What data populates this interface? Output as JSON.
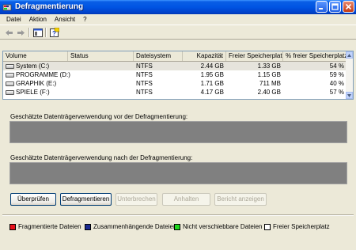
{
  "window": {
    "title": "Defragmentierung"
  },
  "menu": [
    "Datei",
    "Aktion",
    "Ansicht",
    "?"
  ],
  "toolbar": {
    "icons": [
      "back-arrow-icon",
      "forward-arrow-icon",
      "console-tree-icon",
      "help-icon"
    ]
  },
  "volume_table": {
    "columns": [
      "Volume",
      "Status",
      "Dateisystem",
      "Kapazität",
      "Freier Speicherplatz",
      "% freier Speicherplatz"
    ],
    "rows": [
      {
        "volume": "System (C:)",
        "status": "",
        "filesystem": "NTFS",
        "capacity": "2.44 GB",
        "free": "1.33 GB",
        "pct_free": "54 %"
      },
      {
        "volume": "PROGRAMME (D:)",
        "status": "",
        "filesystem": "NTFS",
        "capacity": "1.95 GB",
        "free": "1.15 GB",
        "pct_free": "59 %"
      },
      {
        "volume": "GRAPHIK (E:)",
        "status": "",
        "filesystem": "NTFS",
        "capacity": "1.71 GB",
        "free": "711 MB",
        "pct_free": "40 %"
      },
      {
        "volume": "SPIELE (F:)",
        "status": "",
        "filesystem": "NTFS",
        "capacity": "4.17 GB",
        "free": "2.40 GB",
        "pct_free": "57 %"
      }
    ]
  },
  "analysis": {
    "before_label": "Geschätzte Datenträgerverwendung vor der Defragmentierung:",
    "after_label": "Geschätzte Datenträgerverwendung nach der Defragmentierung:"
  },
  "buttons": {
    "check": "Überprüfen",
    "defrag": "Defragmentieren",
    "pause": "Unterbrechen",
    "stop": "Anhalten",
    "report": "Bericht anzeigen"
  },
  "legend": [
    {
      "label": "Fragmentierte Dateien",
      "color": "#e8101a"
    },
    {
      "label": "Zusammenhängende Dateien",
      "color": "#1a2a90"
    },
    {
      "label": "Nicht verschiebbare Dateien",
      "color": "#1ed81e"
    },
    {
      "label": "Freier Speicherplatz",
      "color": "#ffffff"
    }
  ],
  "colors": {
    "titlebar": "#0054e3",
    "analysis_bar": "#808080"
  }
}
